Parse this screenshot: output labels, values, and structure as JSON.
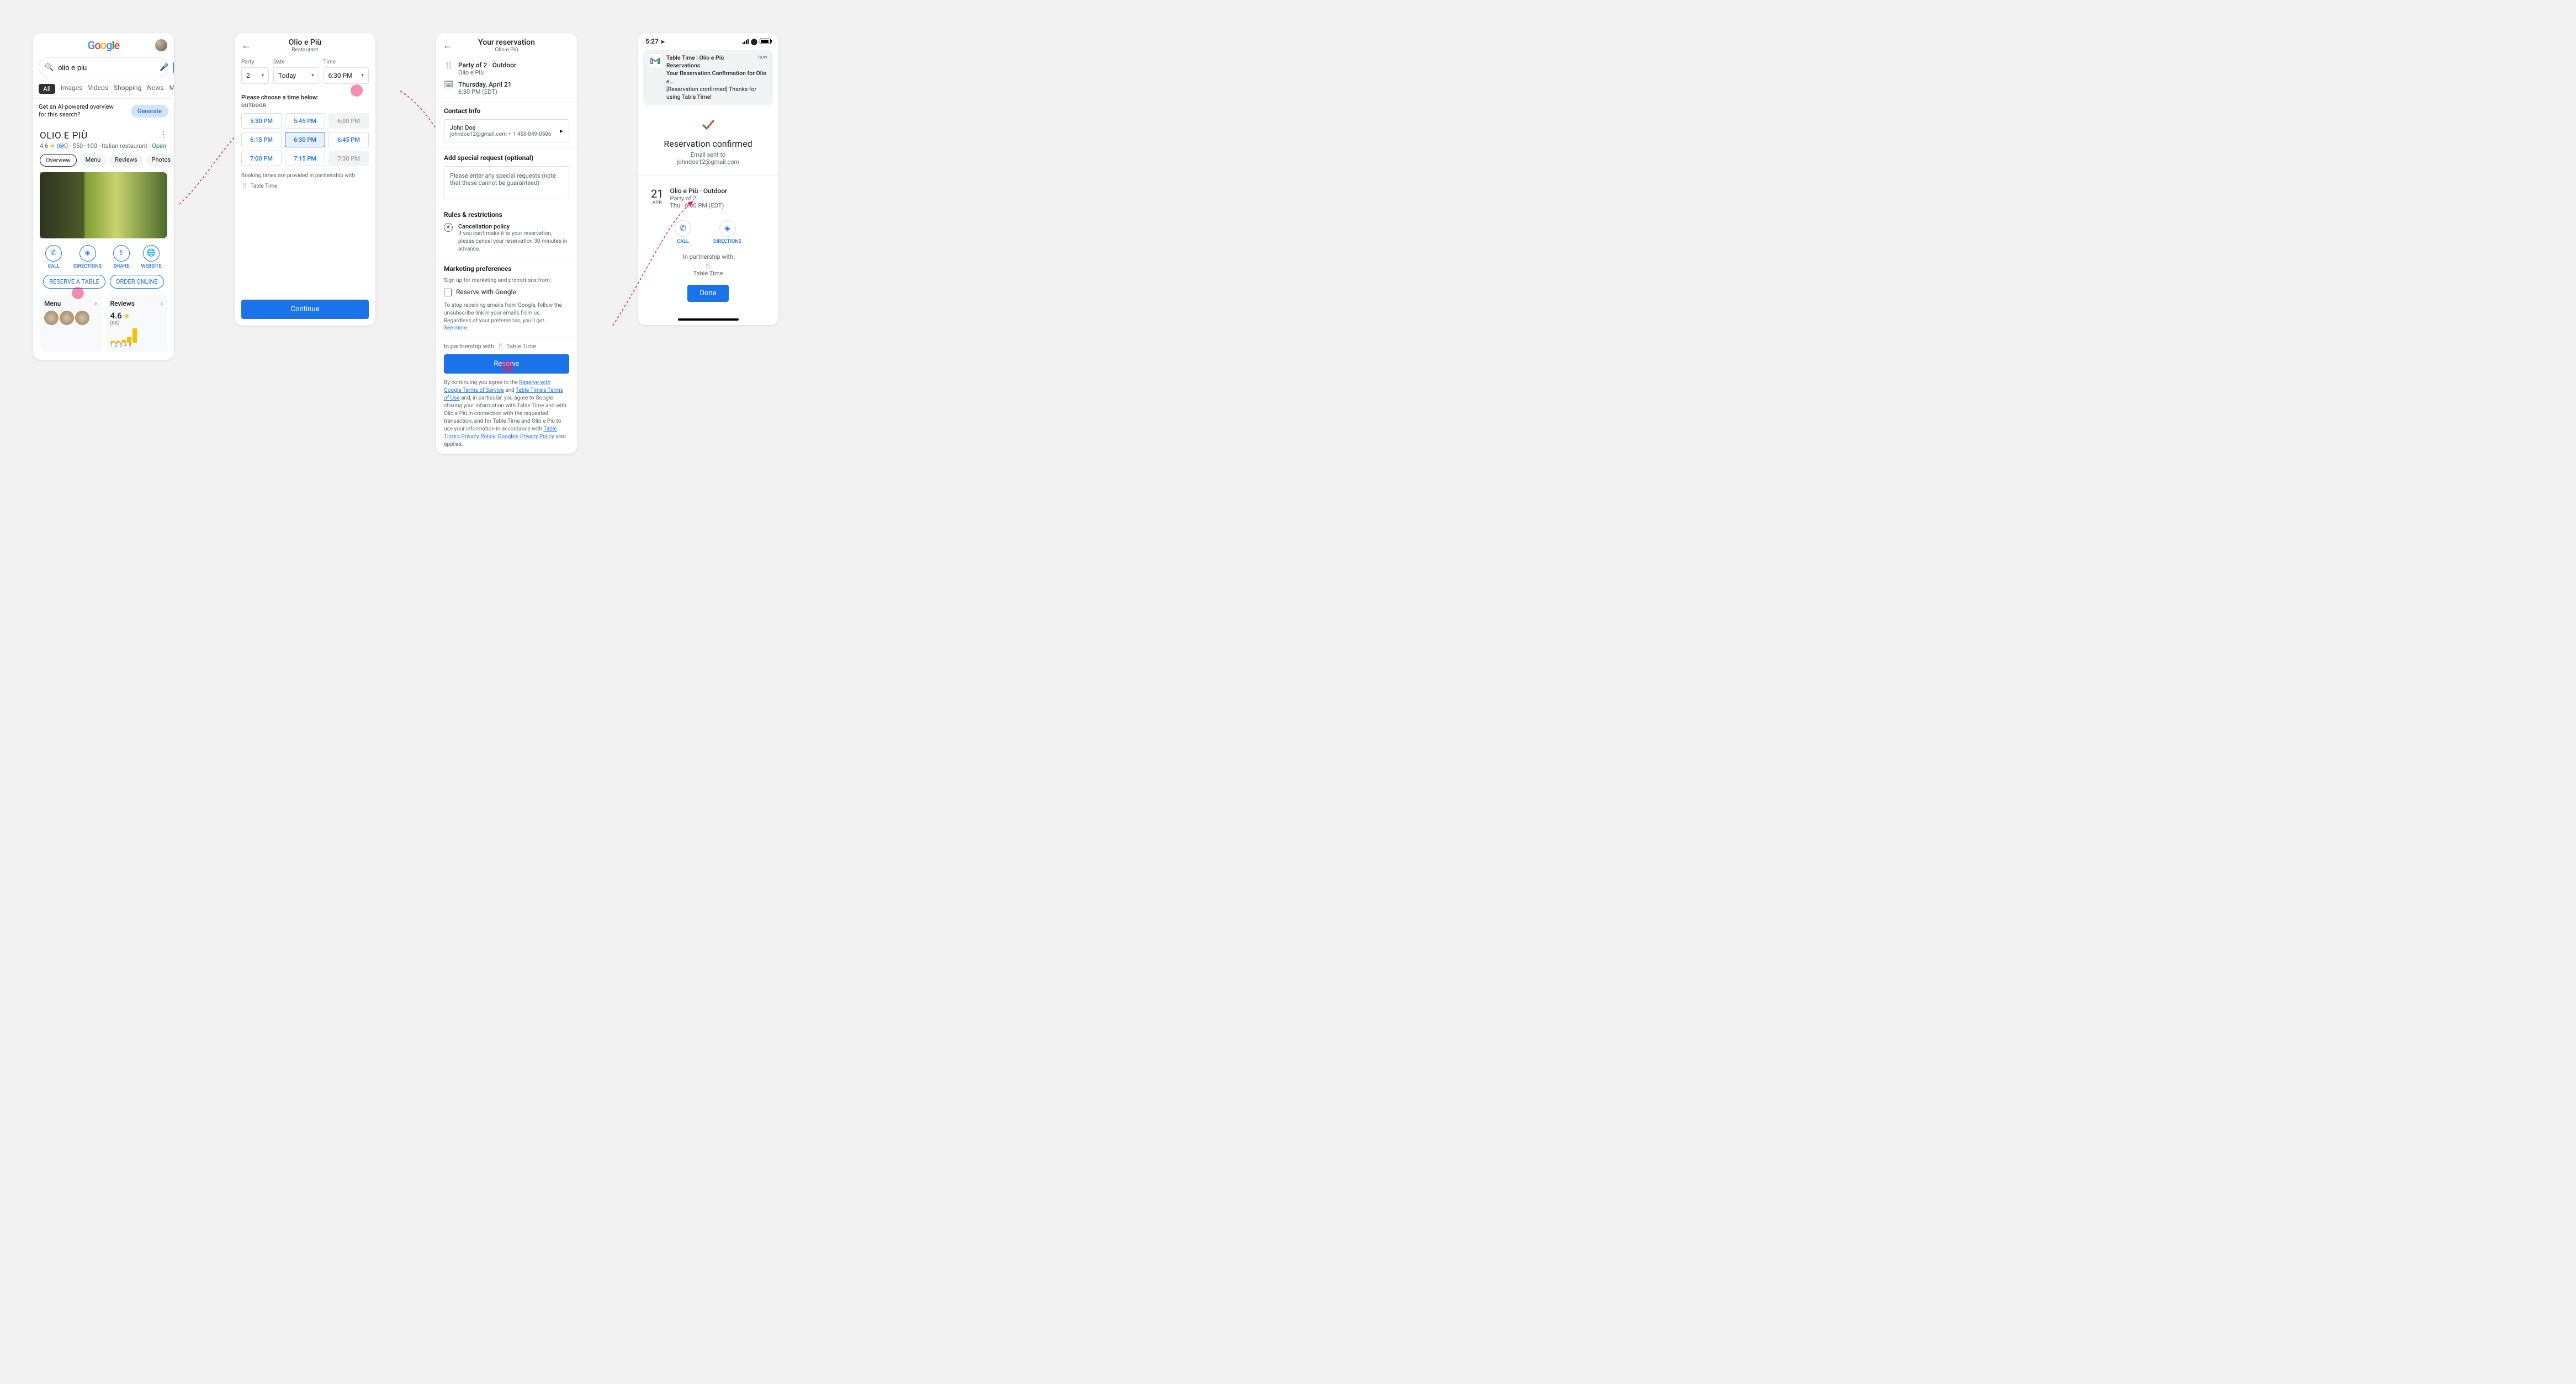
{
  "screen1": {
    "logo_letters": [
      "G",
      "o",
      "o",
      "g",
      "l",
      "e"
    ],
    "search_value": "olio e piu",
    "tabs": [
      "All",
      "Images",
      "Videos",
      "Shopping",
      "News",
      "Maps"
    ],
    "ai_text": "Get an AI-powered overview for this search?",
    "generate": "Generate",
    "name": "OLIO E PIÙ",
    "rating": "4.6",
    "reviews": "(6K)",
    "price": "$50–100",
    "cuisine": "Italian restaurant",
    "open": "Open",
    "chips": [
      "Overview",
      "Menu",
      "Reviews",
      "Photos"
    ],
    "actions": [
      "CALL",
      "DIRECTIONS",
      "SHARE",
      "WEBSITE"
    ],
    "reserve": "RESERVE A TABLE",
    "order": "ORDER ONLINE",
    "menu_card": "Menu",
    "reviews_card": "Reviews",
    "reviews_rating": "4.6",
    "reviews_count": "(6K)",
    "bar_labels": [
      "1",
      "2",
      "3",
      "4",
      "5"
    ]
  },
  "screen2": {
    "title": "Olio e Più",
    "subtitle": "Restaurant",
    "party_label": "Party",
    "party_value": "2",
    "date_label": "Date",
    "date_value": "Today",
    "time_label": "Time",
    "time_value": "6:30 PM",
    "choose": "Please choose a time below:",
    "section": "OUTDOOR",
    "times": [
      {
        "t": "5:30 PM",
        "state": ""
      },
      {
        "t": "5:45 PM",
        "state": ""
      },
      {
        "t": "6:00 PM",
        "state": "dis"
      },
      {
        "t": "6:15 PM",
        "state": ""
      },
      {
        "t": "6:30 PM",
        "state": "sel"
      },
      {
        "t": "6:45 PM",
        "state": ""
      },
      {
        "t": "7:00 PM",
        "state": ""
      },
      {
        "t": "7:15 PM",
        "state": ""
      },
      {
        "t": "7:30 PM",
        "state": "dis"
      }
    ],
    "partner_text": "Booking times are provided in partnership with",
    "partner_name": "Table Time",
    "continue": "Continue"
  },
  "screen3": {
    "title": "Your reservation",
    "subtitle": "Olio e Più",
    "party_line": "Party of 2 · Outdoor",
    "party_sub": "Olio e Più",
    "date_line": "Thursday, April 21",
    "date_sub": "6:30 PM (EDT)",
    "contact_title": "Contact Info",
    "contact_name": "John Doe",
    "contact_detail": "johndoe12@gmail.com   + 1 458-849-0506",
    "special_title": "Add special request (optional)",
    "special_placeholder": "Please enter any special requests (note that these cannot be guaranteed)",
    "rules_title": "Rules & restrictions",
    "cancel_title": "Cancellation policy",
    "cancel_body": "If you can't make it to your reservation, please cancel your reservation 30 minutes in advance.",
    "marketing_title": "Marketing preferences",
    "marketing_sub": "Sign up for marketing and promotions from:",
    "marketing_opt": "Reserve with Google",
    "fine_print": "To stop receiving emails from Google, follow the unsubscribe link in your emails from us. Regardless of your preferences, you'll get...",
    "see_more": "See more",
    "partner_line": "In partnership with",
    "partner_name": "Table Time",
    "reserve": "Reserve",
    "legal_intro": "By continuing you agree to the",
    "legal_link1": "Reserve with Google Terms of Service",
    "legal_and": "and",
    "legal_link2": "Table Time's Terms of Use",
    "legal_mid": "and, in particular, you agree to Google sharing your information with  Table Time and with Olio e Più in connection with the requested transaction, and for Table Time  and Olio e Più to use your information in accordance with",
    "legal_link3": "Table Time's Privacy Policy",
    "legal_link4": "Google's Privacy Policy",
    "legal_tail": "also applies."
  },
  "screen4": {
    "status_time": "5:27",
    "notif_title": "Table Time | Olio e Più Reservations",
    "notif_time": "now",
    "notif_line2": "Your Reservation Confirmation for Olio e...",
    "notif_line3": "[Reservation confirmed] Thanks for using Table Time!",
    "confirmed": "Reservation confirmed",
    "email_sent": "Email sent to",
    "email": "johndoe12@gmail.com",
    "day_num": "21",
    "day_mon": "APR",
    "venue": "Olio e Più · Outdoor",
    "party": "Party of 2",
    "when": "Thu · 6:30 PM (EDT)",
    "call": "CALL",
    "directions": "DIRECTIONS",
    "partner_line": "In partnership with",
    "partner_name": "Table Time",
    "done": "Done"
  }
}
